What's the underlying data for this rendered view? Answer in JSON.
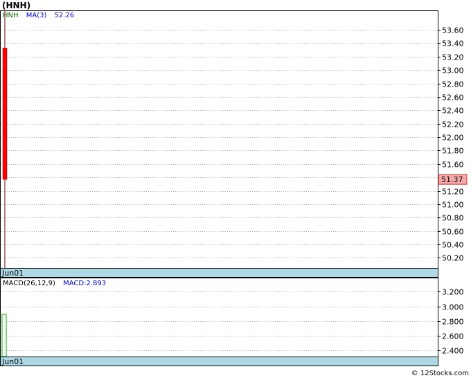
{
  "page": {
    "symbol_title": "(HNH)",
    "footer": "© 12Stocks.com"
  },
  "colors": {
    "up": "#00aa00",
    "down": "#ff0000",
    "date_band": "#add8e6",
    "grid": "#aaaaaa",
    "ma_label": "#0000cc",
    "symbol_label": "#006600",
    "price_tag": "#f4a9a9"
  },
  "price_panel": {
    "legend_symbol": "HNH",
    "legend_ma": "MA(3)",
    "legend_ma_value": "52.26",
    "date_label": "Jun01",
    "last_price_tag": "51.37"
  },
  "macd_panel": {
    "legend_name": "MACD(26,12,9)",
    "legend_value": "MACD:2.893",
    "date_label": "Jun01"
  },
  "chart_data": [
    {
      "type": "candlestick",
      "title": "(HNH)",
      "x": [
        "Jun01"
      ],
      "series": [
        {
          "name": "HNH",
          "open": [
            53.33
          ],
          "close": [
            51.37
          ],
          "high": [
            53.88
          ],
          "low": [
            50.05
          ]
        },
        {
          "name": "MA(3)",
          "values": [
            52.26
          ]
        }
      ],
      "ylim": [
        50.05,
        53.88
      ],
      "yticks": [
        50.2,
        50.4,
        50.6,
        50.8,
        51.0,
        51.2,
        51.4,
        51.6,
        51.8,
        52.0,
        52.2,
        52.4,
        52.6,
        52.8,
        53.0,
        53.2,
        53.4,
        53.6
      ],
      "ytick_labels": [
        "50.20",
        "50.40",
        "50.60",
        "50.80",
        "51.00",
        "51.20",
        "51.40",
        "51.60",
        "51.80",
        "52.00",
        "52.20",
        "52.40",
        "52.60",
        "52.80",
        "53.00",
        "53.20",
        "53.40",
        "53.60"
      ],
      "last_price": 51.37,
      "grid": true
    },
    {
      "type": "bar",
      "title": "MACD(26,12,9)",
      "x": [
        "Jun01"
      ],
      "series": [
        {
          "name": "MACD",
          "values": [
            2.893
          ]
        }
      ],
      "ylim": [
        2.32,
        3.38
      ],
      "yticks": [
        2.4,
        2.6,
        2.8,
        3.0,
        3.2
      ],
      "ytick_labels": [
        "2.400",
        "2.600",
        "2.800",
        "3.000",
        "3.200"
      ],
      "grid": true
    }
  ]
}
